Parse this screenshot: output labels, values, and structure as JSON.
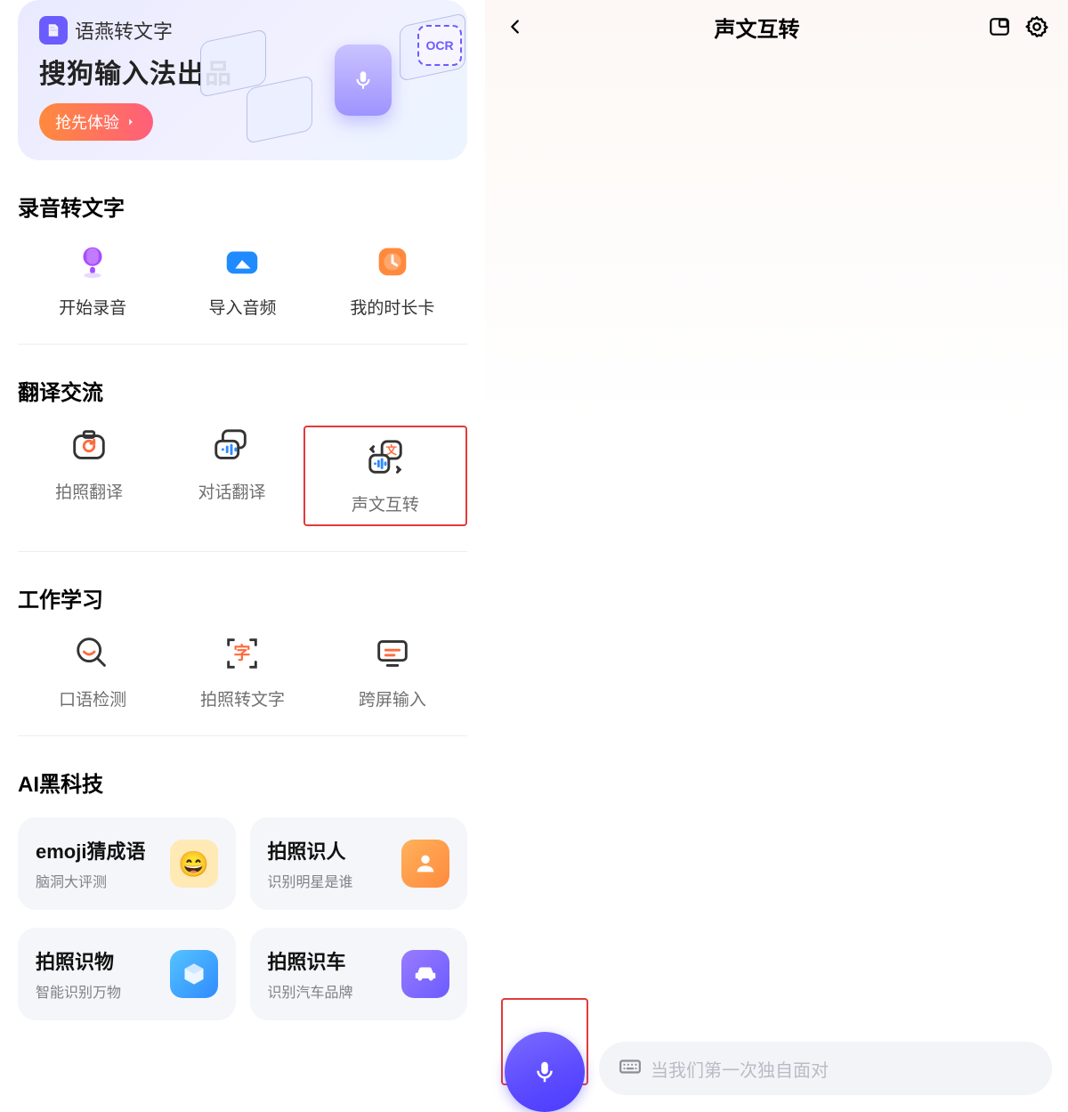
{
  "promo": {
    "brand": "语燕转文字",
    "headline": "搜狗输入法出品",
    "cta": "抢先体验",
    "ocr_tag": "OCR"
  },
  "sections": {
    "record": {
      "title": "录音转文字",
      "items": [
        "开始录音",
        "导入音频",
        "我的时长卡"
      ]
    },
    "translate": {
      "title": "翻译交流",
      "items": [
        "拍照翻译",
        "对话翻译",
        "声文互转"
      ]
    },
    "work": {
      "title": "工作学习",
      "items": [
        "口语检测",
        "拍照转文字",
        "跨屏输入"
      ]
    },
    "ai": {
      "title": "AI黑科技",
      "cards": [
        {
          "t1": "emoji猜成语",
          "t2": "脑洞大评测"
        },
        {
          "t1": "拍照识人",
          "t2": "识别明星是谁"
        },
        {
          "t1": "拍照识物",
          "t2": "智能识别万物"
        },
        {
          "t1": "拍照识车",
          "t2": "识别汽车品牌"
        }
      ]
    }
  },
  "right": {
    "title": "声文互转",
    "placeholder": "当我们第一次独自面对"
  }
}
